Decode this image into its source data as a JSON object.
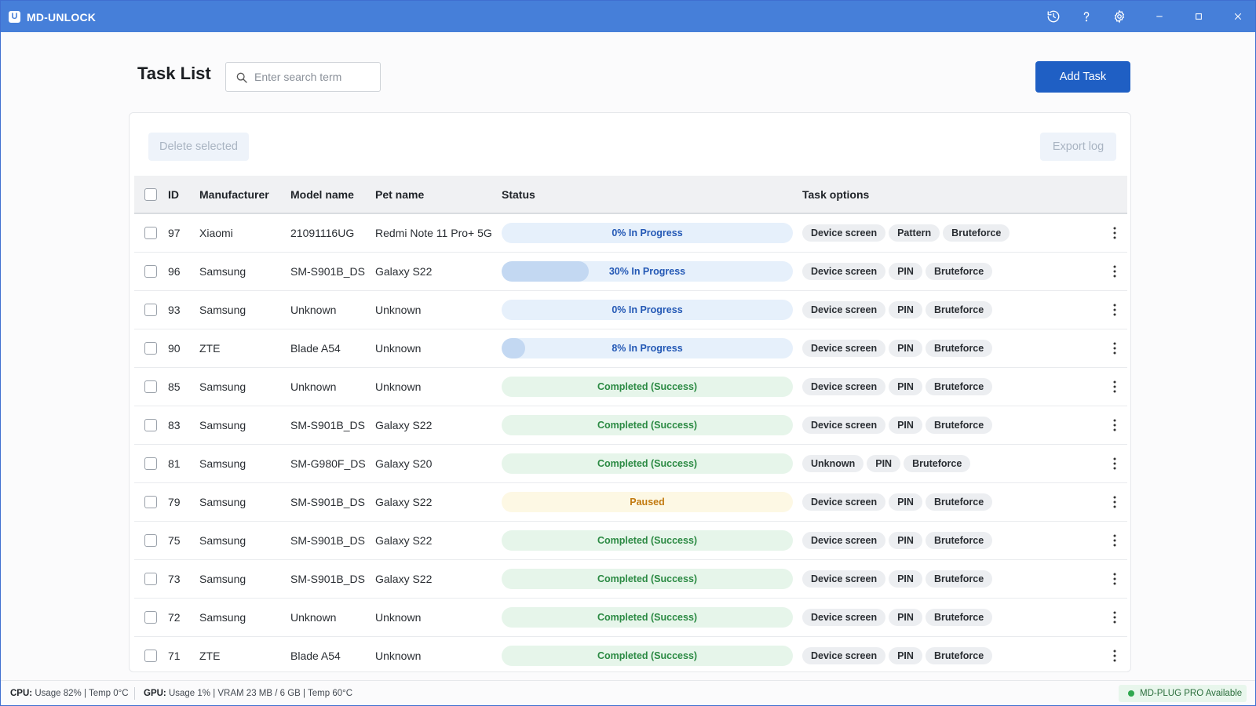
{
  "window": {
    "app_name": "MD-UNLOCK",
    "logo_letter": "U",
    "icons": [
      "history-icon",
      "help-icon",
      "settings-icon",
      "minimize-icon",
      "maximize-icon",
      "close-icon"
    ]
  },
  "header": {
    "title": "Task List",
    "search_placeholder": "Enter search term",
    "search_value": "",
    "add_task_label": "Add Task"
  },
  "toolbar": {
    "delete_selected_label": "Delete selected",
    "export_log_label": "Export log"
  },
  "table": {
    "columns": {
      "id": "ID",
      "manufacturer": "Manufacturer",
      "model": "Model name",
      "pet": "Pet name",
      "status": "Status",
      "options": "Task options"
    },
    "rows": [
      {
        "id": "97",
        "manufacturer": "Xiaomi",
        "model": "21091116UG",
        "pet": "Redmi Note 11 Pro+ 5G",
        "status_type": "progress",
        "progress": 0,
        "status_text": "0% In Progress",
        "options": [
          "Device screen",
          "Pattern",
          "Bruteforce"
        ]
      },
      {
        "id": "96",
        "manufacturer": "Samsung",
        "model": "SM-S901B_DS",
        "pet": "Galaxy S22",
        "status_type": "progress",
        "progress": 30,
        "status_text": "30% In Progress",
        "options": [
          "Device screen",
          "PIN",
          "Bruteforce"
        ]
      },
      {
        "id": "93",
        "manufacturer": "Samsung",
        "model": "Unknown",
        "pet": "Unknown",
        "status_type": "progress",
        "progress": 0,
        "status_text": "0% In Progress",
        "options": [
          "Device screen",
          "PIN",
          "Bruteforce"
        ]
      },
      {
        "id": "90",
        "manufacturer": "ZTE",
        "model": "Blade A54",
        "pet": "Unknown",
        "status_type": "progress",
        "progress": 8,
        "status_text": "8% In Progress",
        "options": [
          "Device screen",
          "PIN",
          "Bruteforce"
        ]
      },
      {
        "id": "85",
        "manufacturer": "Samsung",
        "model": "Unknown",
        "pet": "Unknown",
        "status_type": "success",
        "progress": 100,
        "status_text": "Completed (Success)",
        "options": [
          "Device screen",
          "PIN",
          "Bruteforce"
        ]
      },
      {
        "id": "83",
        "manufacturer": "Samsung",
        "model": "SM-S901B_DS",
        "pet": "Galaxy S22",
        "status_type": "success",
        "progress": 100,
        "status_text": "Completed (Success)",
        "options": [
          "Device screen",
          "PIN",
          "Bruteforce"
        ]
      },
      {
        "id": "81",
        "manufacturer": "Samsung",
        "model": "SM-G980F_DS",
        "pet": "Galaxy S20",
        "status_type": "success",
        "progress": 100,
        "status_text": "Completed (Success)",
        "options": [
          "Unknown",
          "PIN",
          "Bruteforce"
        ]
      },
      {
        "id": "79",
        "manufacturer": "Samsung",
        "model": "SM-S901B_DS",
        "pet": "Galaxy S22",
        "status_type": "paused",
        "progress": 0,
        "status_text": "Paused",
        "options": [
          "Device screen",
          "PIN",
          "Bruteforce"
        ]
      },
      {
        "id": "75",
        "manufacturer": "Samsung",
        "model": "SM-S901B_DS",
        "pet": "Galaxy S22",
        "status_type": "success",
        "progress": 100,
        "status_text": "Completed (Success)",
        "options": [
          "Device screen",
          "PIN",
          "Bruteforce"
        ]
      },
      {
        "id": "73",
        "manufacturer": "Samsung",
        "model": "SM-S901B_DS",
        "pet": "Galaxy S22",
        "status_type": "success",
        "progress": 100,
        "status_text": "Completed (Success)",
        "options": [
          "Device screen",
          "PIN",
          "Bruteforce"
        ]
      },
      {
        "id": "72",
        "manufacturer": "Samsung",
        "model": "Unknown",
        "pet": "Unknown",
        "status_type": "success",
        "progress": 100,
        "status_text": "Completed (Success)",
        "options": [
          "Device screen",
          "PIN",
          "Bruteforce"
        ]
      },
      {
        "id": "71",
        "manufacturer": "ZTE",
        "model": "Blade A54",
        "pet": "Unknown",
        "status_type": "success",
        "progress": 100,
        "status_text": "Completed (Success)",
        "options": [
          "Device screen",
          "PIN",
          "Bruteforce"
        ]
      }
    ]
  },
  "statusbar": {
    "cpu_label": "CPU:",
    "cpu_text": " Usage 82% | Temp 0°C",
    "gpu_label": "GPU:",
    "gpu_text": " Usage 1% | VRAM 23 MB / 6 GB | Temp 60°C",
    "plug_text": "MD-PLUG PRO Available"
  },
  "colors": {
    "titlebar": "#467fd9",
    "primary_button": "#1f5fc4",
    "progress_text": "#2358b5",
    "success_text": "#2b8a43",
    "paused_text": "#c27a10",
    "plug_dot": "#2fa84f"
  }
}
